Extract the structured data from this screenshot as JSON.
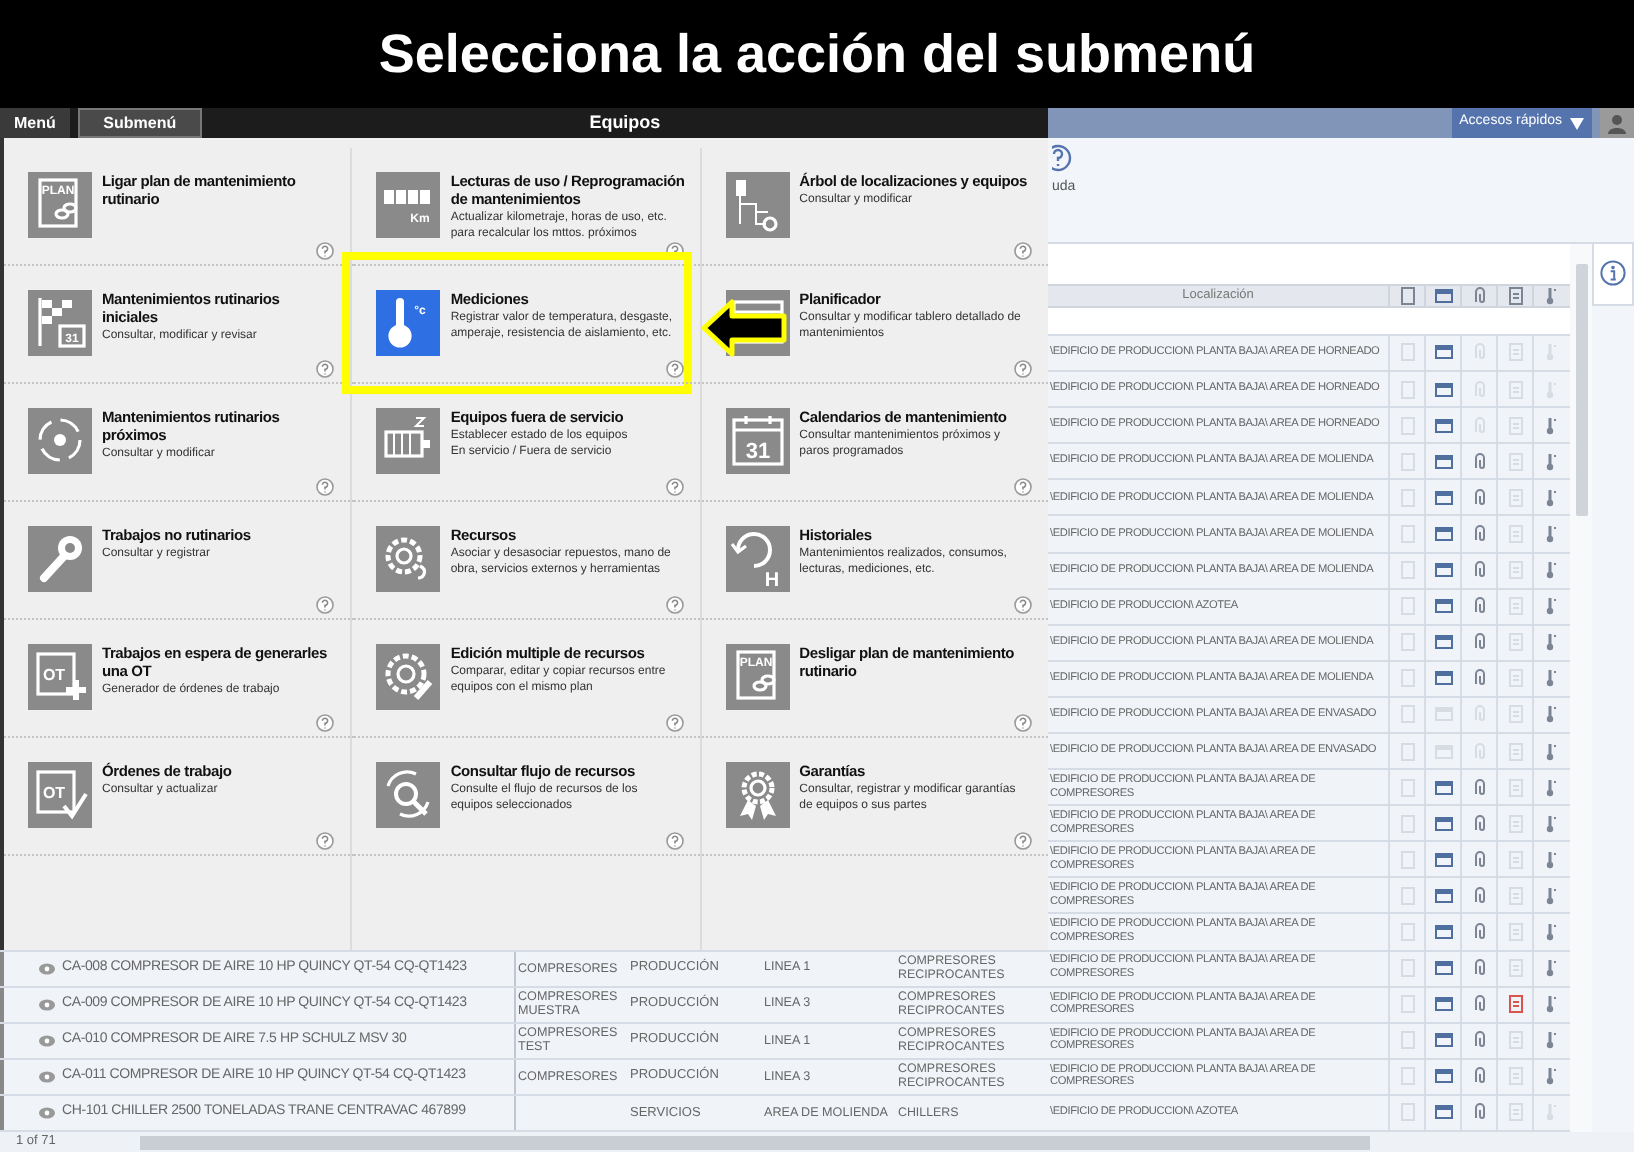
{
  "banner": {
    "title": "Selecciona la acción del submenú"
  },
  "header": {
    "menu_label": "Menú",
    "submenu_label": "Submenú",
    "title": "Equipos",
    "quick_access": "Accesos rápidos"
  },
  "help": {
    "label": "uda"
  },
  "menu": {
    "columns": [
      {
        "items": [
          {
            "title": "Ligar plan de mantenimiento rutinario",
            "kind": "plan",
            "icon_text": "PLAN",
            "selected": false
          },
          {
            "title": "Mantenimientos rutinarios iniciales",
            "description": "Consultar, modificar  y revisar",
            "kind": "flag",
            "icon_text": "31",
            "selected": false
          },
          {
            "title": "Mantenimientos rutinarios próximos",
            "description": "Consultar y modificar",
            "kind": "cycle",
            "selected": false
          },
          {
            "title": "Trabajos no rutinarios",
            "description": "Consultar y registrar",
            "kind": "wrench",
            "selected": false
          },
          {
            "title": "Trabajos en espera de generarles una OT",
            "description": "Generador de órdenes de trabajo",
            "kind": "otplus",
            "icon_text": "OT",
            "selected": false
          },
          {
            "title": "Órdenes de trabajo",
            "description": "Consultar y actualizar",
            "kind": "otcheck",
            "icon_text": "OT",
            "selected": false
          }
        ]
      },
      {
        "items": [
          {
            "title": "Lecturas de uso / Reprogramación de mantenimientos",
            "description": "Actualizar kilometraje, horas de uso, etc. para recalcular los mttos. próximos",
            "kind": "counter",
            "icon_text": "Km",
            "selected": false
          },
          {
            "title": "Mediciones",
            "description": "Registrar valor de temperatura, desgaste, amperaje, resistencia de aislamiento, etc.",
            "kind": "thermometer",
            "icon_text": "°c",
            "selected": true
          },
          {
            "title": "Equipos fuera de servicio",
            "description": "Establecer estado de los equipos\nEn servicio / Fuera de servicio",
            "kind": "motor",
            "selected": false
          },
          {
            "title": "Recursos",
            "description": "Asociar y desasociar repuestos, mano de obra, servicios externos y herramientas",
            "kind": "gear",
            "selected": false
          },
          {
            "title": "Edición multiple de recursos",
            "description": "Comparar, editar y copiar recursos entre equipos con el mismo  plan",
            "kind": "gearedit",
            "selected": false
          },
          {
            "title": "Consultar flujo de recursos",
            "description": "Consulte el flujo de recursos de los equipos seleccionados",
            "kind": "gearsearch",
            "selected": false
          }
        ]
      },
      {
        "items": [
          {
            "title": "Árbol de localizaciones y equipos",
            "description": "Consultar y modificar",
            "kind": "tree",
            "selected": false
          },
          {
            "title": "Planificador",
            "description": "Consultar y modificar tablero detallado de mantenimientos",
            "kind": "planner",
            "selected": false
          },
          {
            "title": "Calendarios de mantenimiento",
            "description": "Consultar mantenimientos próximos y paros programados",
            "kind": "calendar",
            "icon_text": "31",
            "selected": false
          },
          {
            "title": "Historiales",
            "description": "Mantenimientos realizados, consumos, lecturas, mediciones, etc.",
            "kind": "history",
            "icon_text": "H",
            "selected": false
          },
          {
            "title": "Desligar plan de mantenimiento rutinario",
            "kind": "plan",
            "icon_text": "PLAN",
            "selected": false
          },
          {
            "title": "Garantías",
            "description": "Consultar, registrar y modificar  garantías de equipos o sus partes",
            "kind": "award",
            "selected": false
          }
        ]
      }
    ]
  },
  "table": {
    "location_header": "Localización",
    "rows": [
      {
        "location": "\\EDIFICIO DE PRODUCCION\\ PLANTA BAJA\\ AREA DE HORNEADO",
        "icons": [
          false,
          true,
          false,
          false,
          false
        ],
        "alert": false
      },
      {
        "location": "\\EDIFICIO DE PRODUCCION\\ PLANTA BAJA\\ AREA DE HORNEADO",
        "icons": [
          false,
          true,
          false,
          false,
          false
        ],
        "alert": false
      },
      {
        "location": "\\EDIFICIO DE PRODUCCION\\ PLANTA BAJA\\ AREA DE HORNEADO",
        "icons": [
          false,
          true,
          false,
          false,
          true
        ],
        "alert": false
      },
      {
        "location": "\\EDIFICIO DE PRODUCCION\\ PLANTA BAJA\\ AREA DE MOLIENDA",
        "icons": [
          false,
          true,
          true,
          false,
          true
        ],
        "alert": false
      },
      {
        "location": "\\EDIFICIO DE PRODUCCION\\ PLANTA BAJA\\ AREA DE MOLIENDA",
        "icons": [
          false,
          true,
          true,
          false,
          true
        ],
        "alert": false
      },
      {
        "location": "\\EDIFICIO DE PRODUCCION\\ PLANTA BAJA\\ AREA DE MOLIENDA",
        "icons": [
          false,
          true,
          true,
          false,
          true
        ],
        "alert": false
      },
      {
        "location": "\\EDIFICIO DE PRODUCCION\\ PLANTA BAJA\\ AREA DE MOLIENDA",
        "icons": [
          false,
          true,
          true,
          false,
          true
        ],
        "alert": false
      },
      {
        "location": "\\EDIFICIO DE PRODUCCION\\ AZOTEA",
        "icons": [
          false,
          true,
          true,
          false,
          true
        ],
        "alert": false
      },
      {
        "location": "\\EDIFICIO DE PRODUCCION\\ PLANTA BAJA\\ AREA DE MOLIENDA",
        "icons": [
          false,
          true,
          true,
          false,
          true
        ],
        "alert": false
      },
      {
        "location": "\\EDIFICIO DE PRODUCCION\\ PLANTA BAJA\\ AREA DE MOLIENDA",
        "icons": [
          false,
          true,
          true,
          false,
          true
        ],
        "alert": false
      },
      {
        "location": "\\EDIFICIO DE PRODUCCION\\ PLANTA BAJA\\ AREA DE ENVASADO",
        "icons": [
          false,
          false,
          false,
          false,
          true
        ],
        "alert": false
      },
      {
        "location": "\\EDIFICIO DE PRODUCCION\\ PLANTA BAJA\\ AREA DE ENVASADO",
        "icons": [
          false,
          false,
          false,
          false,
          true
        ],
        "alert": false
      },
      {
        "location": "\\EDIFICIO DE PRODUCCION\\ PLANTA BAJA\\ AREA DE COMPRESORES",
        "icons": [
          false,
          true,
          true,
          false,
          true
        ],
        "alert": false
      },
      {
        "location": "\\EDIFICIO DE PRODUCCION\\ PLANTA BAJA\\ AREA DE COMPRESORES",
        "icons": [
          false,
          true,
          true,
          false,
          true
        ],
        "alert": false
      },
      {
        "location": "\\EDIFICIO DE PRODUCCION\\ PLANTA BAJA\\ AREA DE COMPRESORES",
        "icons": [
          false,
          true,
          true,
          false,
          true
        ],
        "alert": false
      },
      {
        "location": "\\EDIFICIO DE PRODUCCION\\ PLANTA BAJA\\ AREA DE COMPRESORES",
        "icons": [
          false,
          true,
          true,
          false,
          true
        ],
        "alert": false
      },
      {
        "location": "\\EDIFICIO DE PRODUCCION\\ PLANTA BAJA\\ AREA DE COMPRESORES",
        "icons": [
          false,
          true,
          true,
          false,
          true
        ],
        "alert": false
      },
      {
        "name": "CA-008 COMPRESOR DE AIRE 10 HP QUINCY QT-54 CQ-QT1423",
        "type": "COMPRESORES",
        "area": "PRODUCCIÓN",
        "line": "LINEA 1",
        "category": "COMPRESORES RECIPROCANTES",
        "location": "\\EDIFICIO DE PRODUCCION\\ PLANTA BAJA\\ AREA DE COMPRESORES",
        "icons": [
          false,
          true,
          true,
          false,
          true
        ],
        "alert": false
      },
      {
        "name": "CA-009 COMPRESOR DE AIRE 10 HP QUINCY QT-54 CQ-QT1423",
        "type": "COMPRESORES MUESTRA",
        "area": "PRODUCCIÓN",
        "line": "LINEA 3",
        "category": "COMPRESORES RECIPROCANTES",
        "location": "\\EDIFICIO DE PRODUCCION\\ PLANTA BAJA\\ AREA DE COMPRESORES",
        "icons": [
          false,
          true,
          true,
          false,
          true
        ],
        "alert": true
      },
      {
        "name": "CA-010 COMPRESOR DE AIRE 7.5 HP SCHULZ MSV 30",
        "type": "COMPRESORES TEST",
        "area": "PRODUCCIÓN",
        "line": "LINEA 1",
        "category": "COMPRESORES RECIPROCANTES",
        "location": "\\EDIFICIO DE PRODUCCION\\ PLANTA BAJA\\ AREA DE COMPRESORES",
        "icons": [
          false,
          true,
          true,
          false,
          true
        ],
        "alert": false
      },
      {
        "name": "CA-011 COMPRESOR DE AIRE 10 HP QUINCY QT-54 CQ-QT1423",
        "type": "COMPRESORES",
        "area": "PRODUCCIÓN",
        "line": "LINEA 3",
        "category": "COMPRESORES RECIPROCANTES",
        "location": "\\EDIFICIO DE PRODUCCION\\ PLANTA BAJA\\ AREA DE COMPRESORES",
        "icons": [
          false,
          true,
          true,
          false,
          true
        ],
        "alert": false
      },
      {
        "name": "CH-101 CHILLER 2500 TONELADAS TRANE CENTRAVAC 467899",
        "area": "SERVICIOS",
        "line": "AREA DE MOLIENDA",
        "category": "CHILLERS",
        "location": "\\EDIFICIO DE PRODUCCION\\ AZOTEA",
        "icons": [
          false,
          true,
          true,
          false,
          false
        ],
        "alert": false
      }
    ]
  },
  "footer": {
    "page": "1 of 71"
  }
}
